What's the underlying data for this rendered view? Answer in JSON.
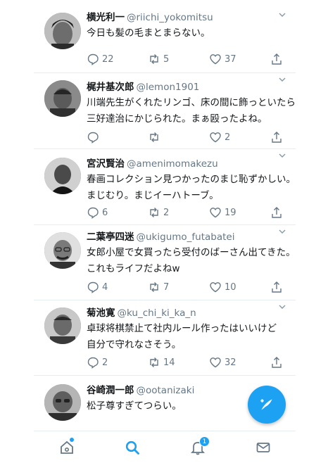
{
  "tweets": [
    {
      "name": "横光利一",
      "handle": "@riichi_yokomitsu",
      "lines": [
        "今日も髪の毛まとまらない。"
      ],
      "reply_count": "22",
      "retweet_count": "5",
      "like_count": "37"
    },
    {
      "name": "梶井基次郎",
      "handle": "@lemon1901",
      "lines": [
        "川端先生がくれたリンゴ、床の間に飾っといたら",
        "三好達治にかじられた。まぁ殴ったよね。"
      ],
      "reply_count": "",
      "retweet_count": "",
      "like_count": "2"
    },
    {
      "name": "宮沢賢治",
      "handle": "@amenimomakezu",
      "lines": [
        "春画コレクション見つかったのまじ恥ずかしい。",
        "まじむり。まじイーハトーブ。"
      ],
      "reply_count": "6",
      "retweet_count": "2",
      "like_count": "19"
    },
    {
      "name": "二葉亭四迷",
      "handle": "@ukigumo_futabatei",
      "lines": [
        "女郎小屋で女買ったら受付のばーさん出てきた。",
        "これもライフだよねw"
      ],
      "reply_count": "4",
      "retweet_count": "7",
      "like_count": "10"
    },
    {
      "name": "菊池寛",
      "handle": "@ku_chi_ki_ka_n",
      "lines": [
        "卓球将棋禁止て社内ルール作ったはいいけど",
        "自分で守れなさそう。"
      ],
      "reply_count": "2",
      "retweet_count": "14",
      "like_count": "32"
    },
    {
      "name": "谷崎潤一郎",
      "handle": "@ootanizaki",
      "lines": [
        "松子尊すぎてつらい。"
      ],
      "reply_count": "",
      "retweet_count": "",
      "like_count": ""
    }
  ],
  "tabbar": {
    "notifications_badge": "1",
    "items": [
      "home-icon",
      "search-icon",
      "notifications-icon",
      "messages-icon"
    ]
  },
  "colors": {
    "accent": "#1da1f2",
    "text": "#14171a",
    "secondary_text": "#657786",
    "divider": "#e6ecf0"
  }
}
